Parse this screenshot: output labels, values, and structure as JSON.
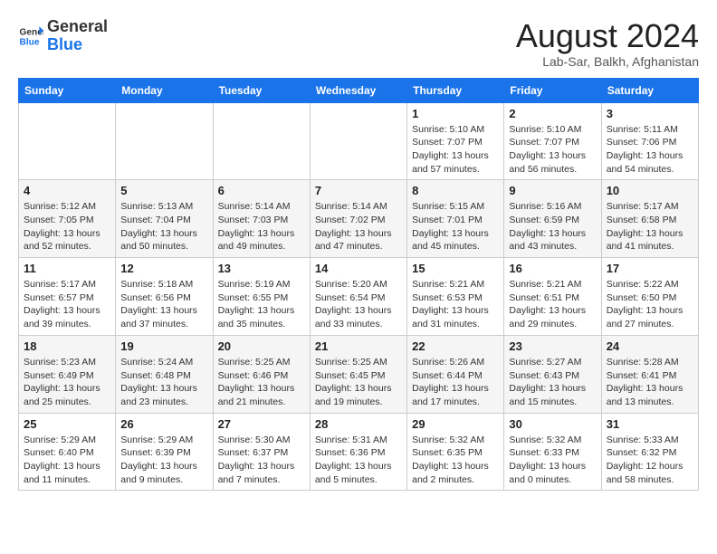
{
  "header": {
    "logo_line1": "General",
    "logo_line2": "Blue",
    "title": "August 2024",
    "subtitle": "Lab-Sar, Balkh, Afghanistan"
  },
  "days_of_week": [
    "Sunday",
    "Monday",
    "Tuesday",
    "Wednesday",
    "Thursday",
    "Friday",
    "Saturday"
  ],
  "weeks": [
    [
      {
        "day": "",
        "info": ""
      },
      {
        "day": "",
        "info": ""
      },
      {
        "day": "",
        "info": ""
      },
      {
        "day": "",
        "info": ""
      },
      {
        "day": "1",
        "info": "Sunrise: 5:10 AM\nSunset: 7:07 PM\nDaylight: 13 hours\nand 57 minutes."
      },
      {
        "day": "2",
        "info": "Sunrise: 5:10 AM\nSunset: 7:07 PM\nDaylight: 13 hours\nand 56 minutes."
      },
      {
        "day": "3",
        "info": "Sunrise: 5:11 AM\nSunset: 7:06 PM\nDaylight: 13 hours\nand 54 minutes."
      }
    ],
    [
      {
        "day": "4",
        "info": "Sunrise: 5:12 AM\nSunset: 7:05 PM\nDaylight: 13 hours\nand 52 minutes."
      },
      {
        "day": "5",
        "info": "Sunrise: 5:13 AM\nSunset: 7:04 PM\nDaylight: 13 hours\nand 50 minutes."
      },
      {
        "day": "6",
        "info": "Sunrise: 5:14 AM\nSunset: 7:03 PM\nDaylight: 13 hours\nand 49 minutes."
      },
      {
        "day": "7",
        "info": "Sunrise: 5:14 AM\nSunset: 7:02 PM\nDaylight: 13 hours\nand 47 minutes."
      },
      {
        "day": "8",
        "info": "Sunrise: 5:15 AM\nSunset: 7:01 PM\nDaylight: 13 hours\nand 45 minutes."
      },
      {
        "day": "9",
        "info": "Sunrise: 5:16 AM\nSunset: 6:59 PM\nDaylight: 13 hours\nand 43 minutes."
      },
      {
        "day": "10",
        "info": "Sunrise: 5:17 AM\nSunset: 6:58 PM\nDaylight: 13 hours\nand 41 minutes."
      }
    ],
    [
      {
        "day": "11",
        "info": "Sunrise: 5:17 AM\nSunset: 6:57 PM\nDaylight: 13 hours\nand 39 minutes."
      },
      {
        "day": "12",
        "info": "Sunrise: 5:18 AM\nSunset: 6:56 PM\nDaylight: 13 hours\nand 37 minutes."
      },
      {
        "day": "13",
        "info": "Sunrise: 5:19 AM\nSunset: 6:55 PM\nDaylight: 13 hours\nand 35 minutes."
      },
      {
        "day": "14",
        "info": "Sunrise: 5:20 AM\nSunset: 6:54 PM\nDaylight: 13 hours\nand 33 minutes."
      },
      {
        "day": "15",
        "info": "Sunrise: 5:21 AM\nSunset: 6:53 PM\nDaylight: 13 hours\nand 31 minutes."
      },
      {
        "day": "16",
        "info": "Sunrise: 5:21 AM\nSunset: 6:51 PM\nDaylight: 13 hours\nand 29 minutes."
      },
      {
        "day": "17",
        "info": "Sunrise: 5:22 AM\nSunset: 6:50 PM\nDaylight: 13 hours\nand 27 minutes."
      }
    ],
    [
      {
        "day": "18",
        "info": "Sunrise: 5:23 AM\nSunset: 6:49 PM\nDaylight: 13 hours\nand 25 minutes."
      },
      {
        "day": "19",
        "info": "Sunrise: 5:24 AM\nSunset: 6:48 PM\nDaylight: 13 hours\nand 23 minutes."
      },
      {
        "day": "20",
        "info": "Sunrise: 5:25 AM\nSunset: 6:46 PM\nDaylight: 13 hours\nand 21 minutes."
      },
      {
        "day": "21",
        "info": "Sunrise: 5:25 AM\nSunset: 6:45 PM\nDaylight: 13 hours\nand 19 minutes."
      },
      {
        "day": "22",
        "info": "Sunrise: 5:26 AM\nSunset: 6:44 PM\nDaylight: 13 hours\nand 17 minutes."
      },
      {
        "day": "23",
        "info": "Sunrise: 5:27 AM\nSunset: 6:43 PM\nDaylight: 13 hours\nand 15 minutes."
      },
      {
        "day": "24",
        "info": "Sunrise: 5:28 AM\nSunset: 6:41 PM\nDaylight: 13 hours\nand 13 minutes."
      }
    ],
    [
      {
        "day": "25",
        "info": "Sunrise: 5:29 AM\nSunset: 6:40 PM\nDaylight: 13 hours\nand 11 minutes."
      },
      {
        "day": "26",
        "info": "Sunrise: 5:29 AM\nSunset: 6:39 PM\nDaylight: 13 hours\nand 9 minutes."
      },
      {
        "day": "27",
        "info": "Sunrise: 5:30 AM\nSunset: 6:37 PM\nDaylight: 13 hours\nand 7 minutes."
      },
      {
        "day": "28",
        "info": "Sunrise: 5:31 AM\nSunset: 6:36 PM\nDaylight: 13 hours\nand 5 minutes."
      },
      {
        "day": "29",
        "info": "Sunrise: 5:32 AM\nSunset: 6:35 PM\nDaylight: 13 hours\nand 2 minutes."
      },
      {
        "day": "30",
        "info": "Sunrise: 5:32 AM\nSunset: 6:33 PM\nDaylight: 13 hours\nand 0 minutes."
      },
      {
        "day": "31",
        "info": "Sunrise: 5:33 AM\nSunset: 6:32 PM\nDaylight: 12 hours\nand 58 minutes."
      }
    ]
  ]
}
